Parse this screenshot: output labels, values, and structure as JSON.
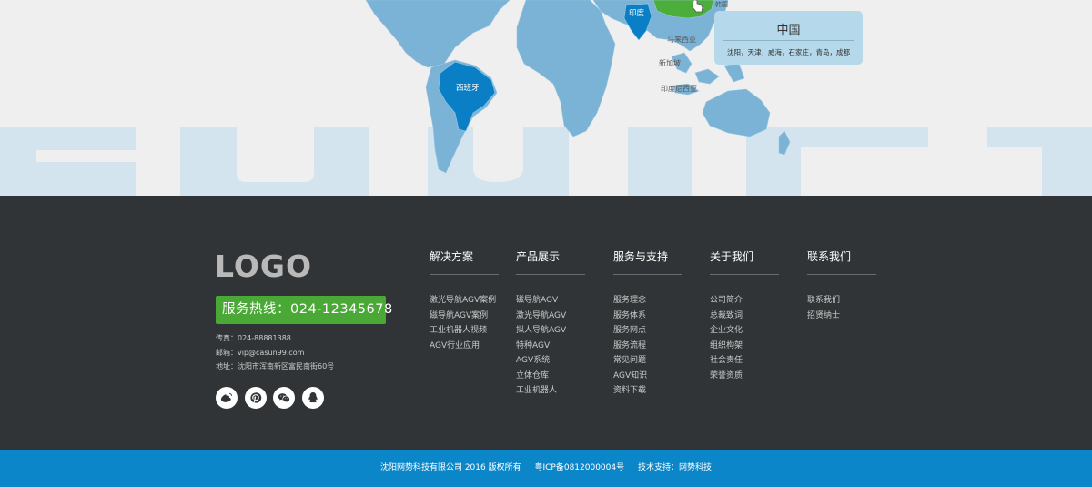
{
  "map": {
    "labels": {
      "india": "印度",
      "korea": "韩国",
      "malaysia": "马来西亚",
      "singapore": "新加坡",
      "indonesia": "印度尼西亚",
      "brazil": "西班牙"
    },
    "tooltip": {
      "title": "中国",
      "cities": "沈阳，天津，威海，石家庄，青岛，成都"
    },
    "colors": {
      "land": "#7ab3d6",
      "highlight": "#0b7fc6",
      "china": "#4cae3a",
      "watermark": "#d3e4ee"
    }
  },
  "footer": {
    "logo": "LOGO",
    "hotline": "服务热线：024-12345678",
    "fax": "传真：024-88881388",
    "email": "邮箱：vip@casun99.com",
    "address": "地址：沈阳市浑南新区富民南街60号",
    "social": [
      "weibo-icon",
      "pinterest-icon",
      "wechat-icon",
      "qq-icon"
    ],
    "columns": [
      {
        "title": "解决方案",
        "items": [
          "激光导航AGV案例",
          "磁导航AGV案例",
          "工业机器人视频",
          "AGV行业应用"
        ]
      },
      {
        "title": "产品展示",
        "items": [
          "磁导航AGV",
          "激光导航AGV",
          "拟人导航AGV",
          "特种AGV",
          "AGV系统",
          "立体仓库",
          "工业机器人"
        ]
      },
      {
        "title": "服务与支持",
        "items": [
          "服务理念",
          "服务体系",
          "服务网点",
          "服务流程",
          "常见问题",
          "AGV知识",
          "资料下载"
        ]
      },
      {
        "title": "关于我们",
        "items": [
          "公司简介",
          "总裁致词",
          "企业文化",
          "组织构架",
          "社会责任",
          "荣誉资质"
        ]
      },
      {
        "title": "联系我们",
        "items": [
          "联系我们",
          "招贤纳士"
        ]
      }
    ]
  },
  "bottom": {
    "copyright": "沈阳网势科技有限公司 2016 版权所有",
    "icp": "粤ICP备0812000004号",
    "support": "技术支持：网势科技"
  }
}
